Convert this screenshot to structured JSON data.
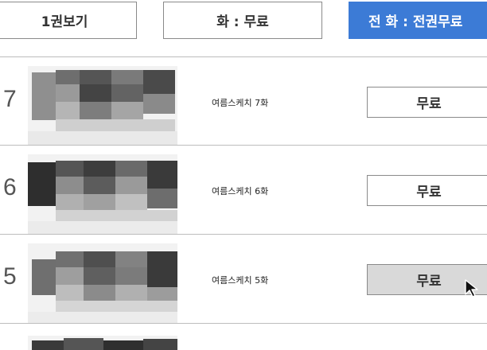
{
  "tabs": [
    {
      "label": "1권보기",
      "selected": false
    },
    {
      "label": "화 : 무료",
      "selected": false
    },
    {
      "label": "전 화 : 전권무료",
      "selected": true
    }
  ],
  "colors": {
    "accent": "#3c7bd6",
    "hover_button": "#d9d9d9"
  },
  "episodes": [
    {
      "number": "7",
      "title": "여름스케치 7화",
      "button_label": "무료"
    },
    {
      "number": "6",
      "title": "여름스케치 6화",
      "button_label": "무료"
    },
    {
      "number": "5",
      "title": "여름스케치 5화",
      "button_label": "무료"
    }
  ]
}
